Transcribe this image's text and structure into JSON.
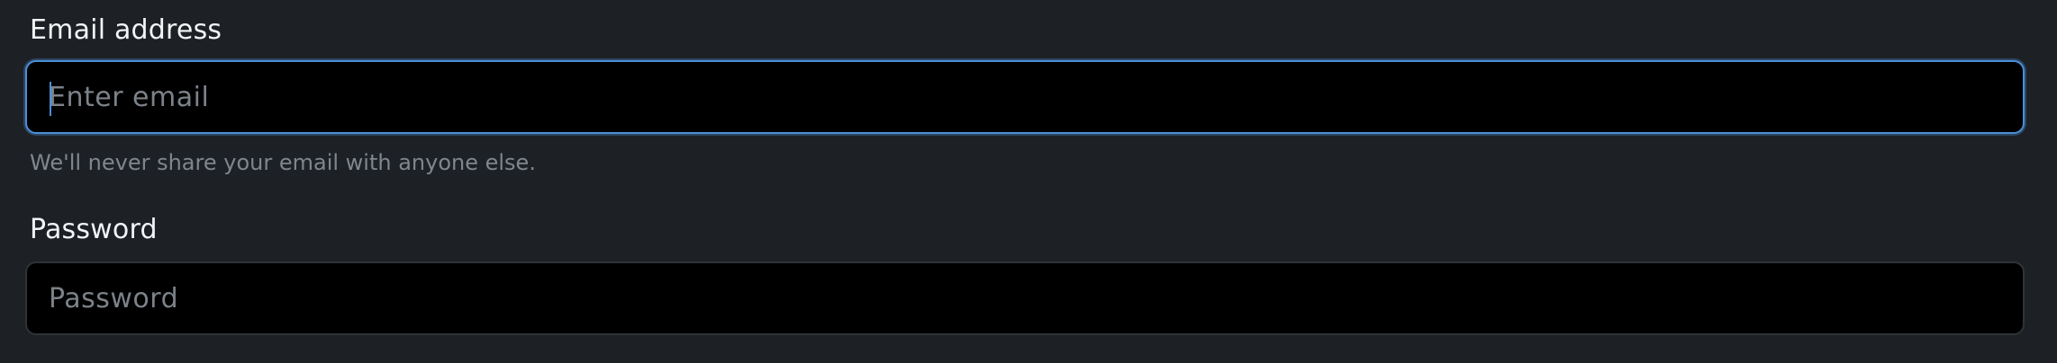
{
  "email": {
    "label": "Email address",
    "placeholder": "Enter email",
    "value": "",
    "help_text": "We'll never share your email with anyone else."
  },
  "password": {
    "label": "Password",
    "placeholder": "Password",
    "value": ""
  },
  "colors": {
    "background": "#1d2125",
    "input_background": "#000000",
    "focus_border": "#4a8fd8",
    "label_text": "#f2f4f6",
    "muted_text": "#7f868d"
  }
}
